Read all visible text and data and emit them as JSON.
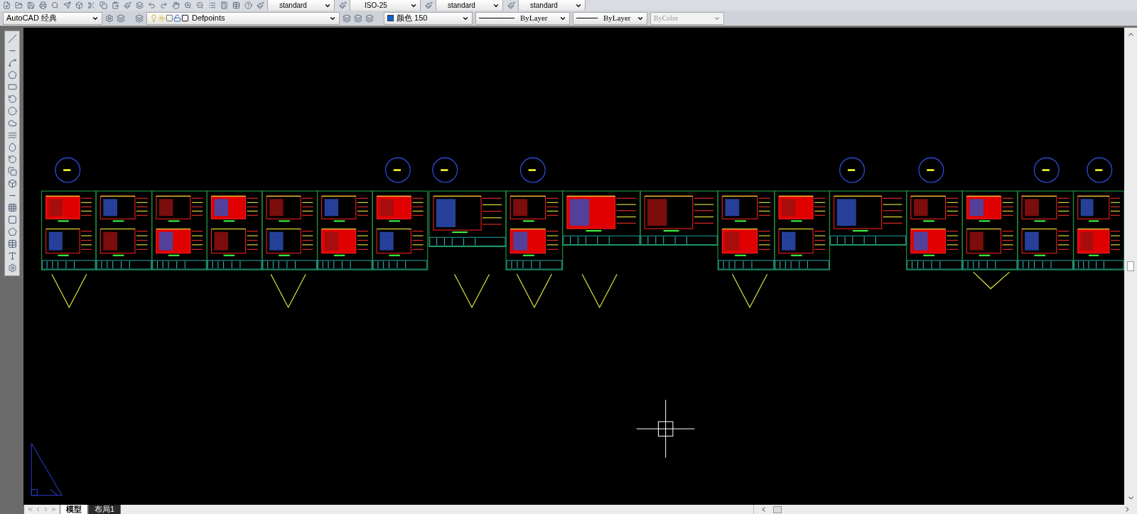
{
  "toolbar_top": {
    "dropdowns": [
      {
        "label": "standard"
      },
      {
        "label": "ISO-25"
      },
      {
        "label": "standard"
      },
      {
        "label": "standard"
      }
    ]
  },
  "toolbar_properties": {
    "workspace": "AutoCAD 经典",
    "layer": "Defpoints",
    "color_control": {
      "text": "颜色 150"
    },
    "linetype": "ByLayer",
    "lineweight": "ByLayer",
    "plotstyle": {
      "value": "ByColor",
      "disabled": true
    }
  },
  "tabs": [
    {
      "label": "模型",
      "selected": true
    },
    {
      "label": "布局1",
      "selected": false
    }
  ]
}
